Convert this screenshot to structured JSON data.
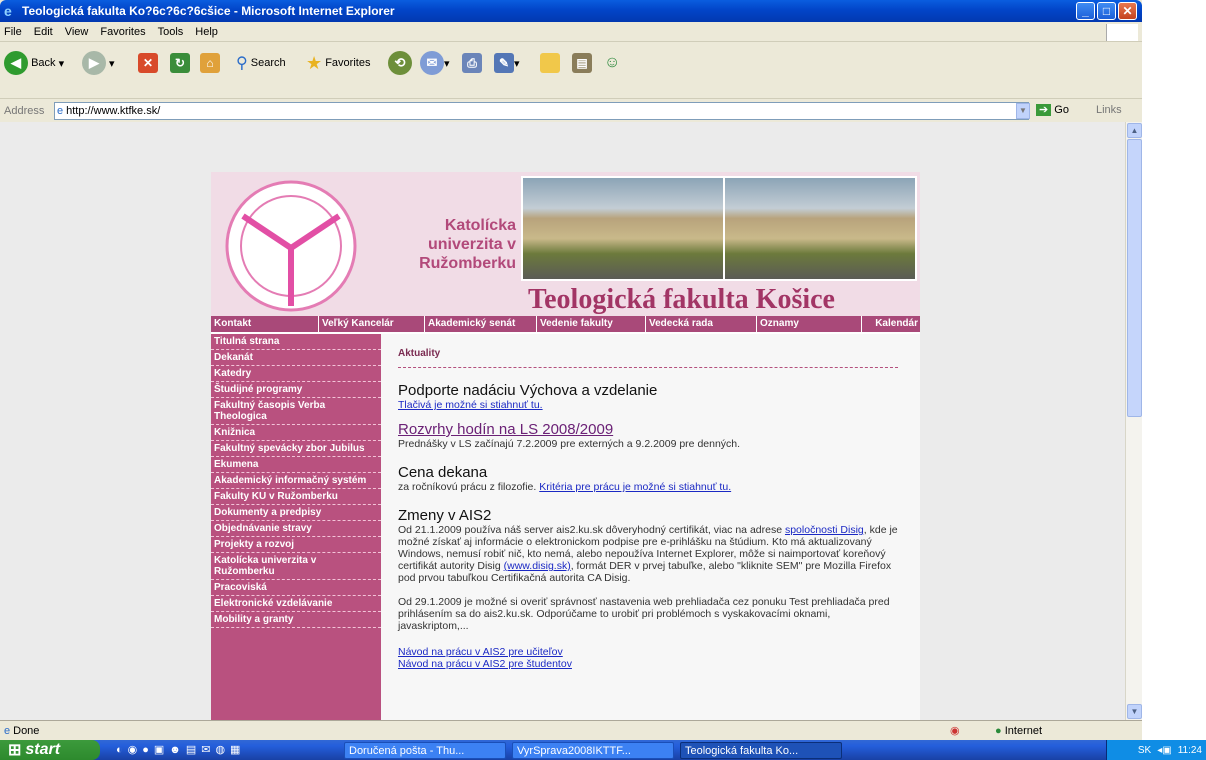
{
  "window": {
    "title": "Teologická fakulta Ko?6c?6c?6cšice - Microsoft Internet Explorer"
  },
  "menu": [
    "File",
    "Edit",
    "View",
    "Favorites",
    "Tools",
    "Help"
  ],
  "toolbar": {
    "back": "Back",
    "search": "Search",
    "favorites": "Favorites"
  },
  "address": {
    "label": "Address",
    "url": "http://www.ktfke.sk/",
    "go": "Go",
    "links": "Links"
  },
  "banner": {
    "university": "Katolícka univerzita v Ružomberku",
    "faculty": "Teologická fakulta Košice"
  },
  "topnav": [
    "Kontakt",
    "Veľký Kancelár",
    "Akademický senát",
    "Vedenie fakulty",
    "Vedecká rada",
    "Oznamy",
    "Kalendár"
  ],
  "sidebar": [
    "Titulná strana",
    "Dekanát",
    "Katedry",
    "Študijné programy",
    "Fakultný časopis Verba Theologica",
    "Knižnica",
    "Fakultný spevácky zbor Jubilus",
    "Ekumena",
    "Akademický informačný systém",
    "Fakulty KU v Ružomberku",
    "Dokumenty a predpisy",
    "Objednávanie stravy",
    "Projekty a rozvoj",
    "Katolícka univerzita v Ružomberku",
    "Pracoviská",
    "Elektronické vzdelávanie",
    "Mobility a granty"
  ],
  "content": {
    "crumb": "Aktuality",
    "n1_title": "Podporte nadáciu Výchova a vzdelanie",
    "n1_link": "Tlačivá je možné si stiahnuť tu.",
    "n2_title": "Rozvrhy hodín na LS 2008/2009",
    "n2_text": "Prednášky v LS začínajú 7.2.2009 pre externých a 9.2.2009 pre denných.",
    "n3_title": "Cena dekana",
    "n3_text": "za ročníkovú prácu z filozofie.",
    "n3_link": "Kritéria pre prácu je možné si stiahnuť tu.",
    "n4_title": "Zmeny v AIS2",
    "n4_a": "Od 21.1.2009 používa náš server ais2.ku.sk dôveryhodný certifikát, viac na adrese",
    "n4_link1": "spoločnosti Disig",
    "n4_b": ", kde je možné získať aj informácie o elektronickom podpise pre e-prihlášku na štúdium. Kto má aktualizovaný Windows, nemusí robiť nič, kto nemá, alebo nepoužíva Internet Explorer, môže si naimportovať koreňový certifikát autority Disig",
    "n4_link2": "(www.disig.sk)",
    "n4_c": ", formát DER v prvej tabuľke, alebo \"kliknite SEM\" pre Mozilla Firefox pod prvou tabuľkou Certifikačná autorita CA Disig.",
    "n4_p2": "Od 29.1.2009 je možné si overiť správnosť nastavenia web prehliadača cez ponuku Test prehliadača pred prihlásením sa do ais2.ku.sk. Odporúčame to urobiť pri problémoch s vyskakovacími oknami, javaskriptom,...",
    "n4_l3": "Návod na prácu v AIS2 pre učiteľov",
    "n4_l4": "Návod na prácu v AIS2 pre študentov"
  },
  "status": {
    "text": "Done",
    "zone": "Internet"
  },
  "taskbar": {
    "start": "start",
    "items": [
      "Doručená pošta - Thu...",
      "VyrSprava2008IKTTF...",
      "Teologická fakulta Ko..."
    ],
    "lang": "SK",
    "time": "11:24"
  }
}
